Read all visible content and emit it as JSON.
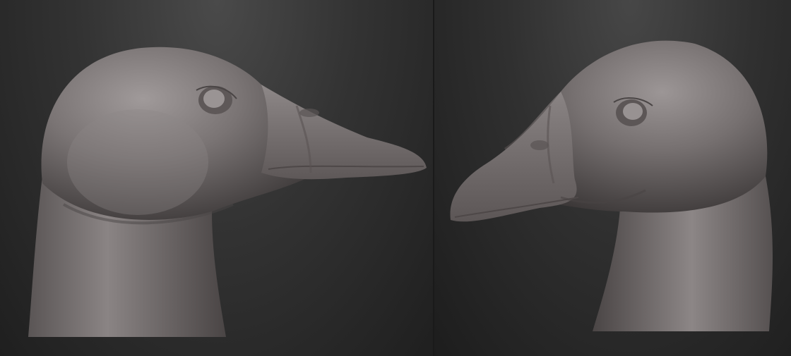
{
  "scene": {
    "background_top": "#4a4a4a",
    "background_bottom": "#1f1f1f",
    "clay_color": "#6e6868",
    "clay_highlight": "#9a9494",
    "clay_shadow": "#3e3a3a"
  },
  "views": [
    {
      "facing": "right"
    },
    {
      "facing": "left"
    }
  ]
}
